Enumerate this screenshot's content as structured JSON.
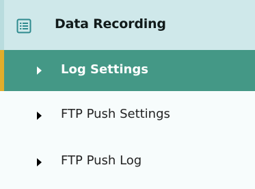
{
  "sidebar": {
    "section": {
      "title": "Data Recording",
      "icon": "list-icon",
      "header_bg": "#cfe8ea"
    },
    "items": [
      {
        "label": "Log Settings",
        "active": true
      },
      {
        "label": "FTP Push Settings",
        "active": false
      },
      {
        "label": "FTP Push Log",
        "active": false
      }
    ],
    "colors": {
      "active_bg": "#449886",
      "active_accent": "#e1ad2c",
      "icon_color": "#2e8a8e"
    }
  }
}
